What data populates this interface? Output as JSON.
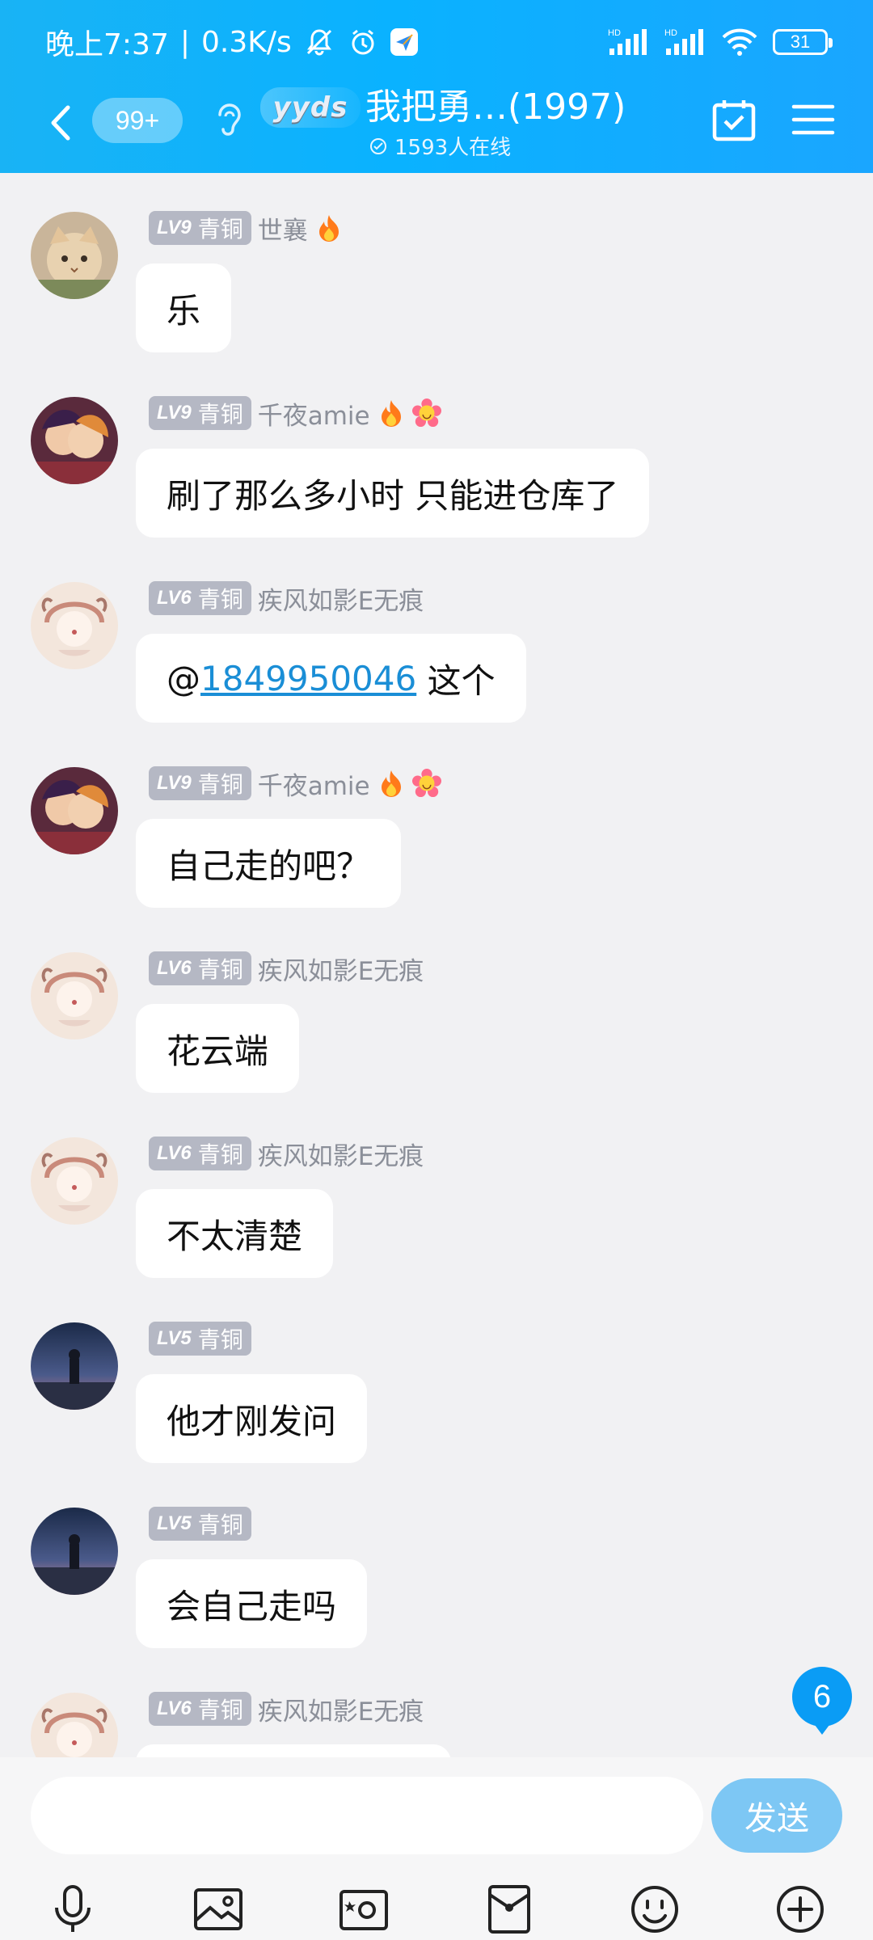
{
  "status_bar": {
    "time": "晚上7:37",
    "network_speed": "0.3K/s",
    "battery": "31",
    "signal_label": "HD"
  },
  "header": {
    "unread_count": "99+",
    "badge_text": "yyds",
    "group_title": "我把勇…(1997)",
    "online_text": "1593人在线"
  },
  "messages": [
    {
      "level": "LV9",
      "rank": "青铜",
      "nick": "世襄",
      "text": "乐"
    },
    {
      "level": "LV9",
      "rank": "青铜",
      "nick": "千夜amie",
      "text": "刷了那么多小时 只能进仓库了"
    },
    {
      "level": "LV6",
      "rank": "青铜",
      "nick": "疾风如影E无痕",
      "text_prefix": "@",
      "mention": "1849950046",
      "text_suffix": " 这个"
    },
    {
      "level": "LV9",
      "rank": "青铜",
      "nick": "千夜amie",
      "text": "自己走的吧？"
    },
    {
      "level": "LV6",
      "rank": "青铜",
      "nick": "疾风如影E无痕",
      "text": "花云端"
    },
    {
      "level": "LV6",
      "rank": "青铜",
      "nick": "疾风如影E无痕",
      "text": "不太清楚"
    },
    {
      "level": "LV5",
      "rank": "青铜",
      "nick": "",
      "text": "他才刚发问"
    },
    {
      "level": "LV5",
      "rank": "青铜",
      "nick": "",
      "text": "会自己走吗"
    },
    {
      "level": "LV6",
      "rank": "青铜",
      "nick": "疾风如影E无痕",
      "text": ""
    }
  ],
  "floating_unread": "6",
  "input": {
    "value": "",
    "send_label": "发送"
  },
  "colors": {
    "header_blue": "#12b0fb",
    "send_button": "#7dc7f4",
    "mention_link": "#1a8ed6",
    "level_badge": "#b5b8c4"
  }
}
